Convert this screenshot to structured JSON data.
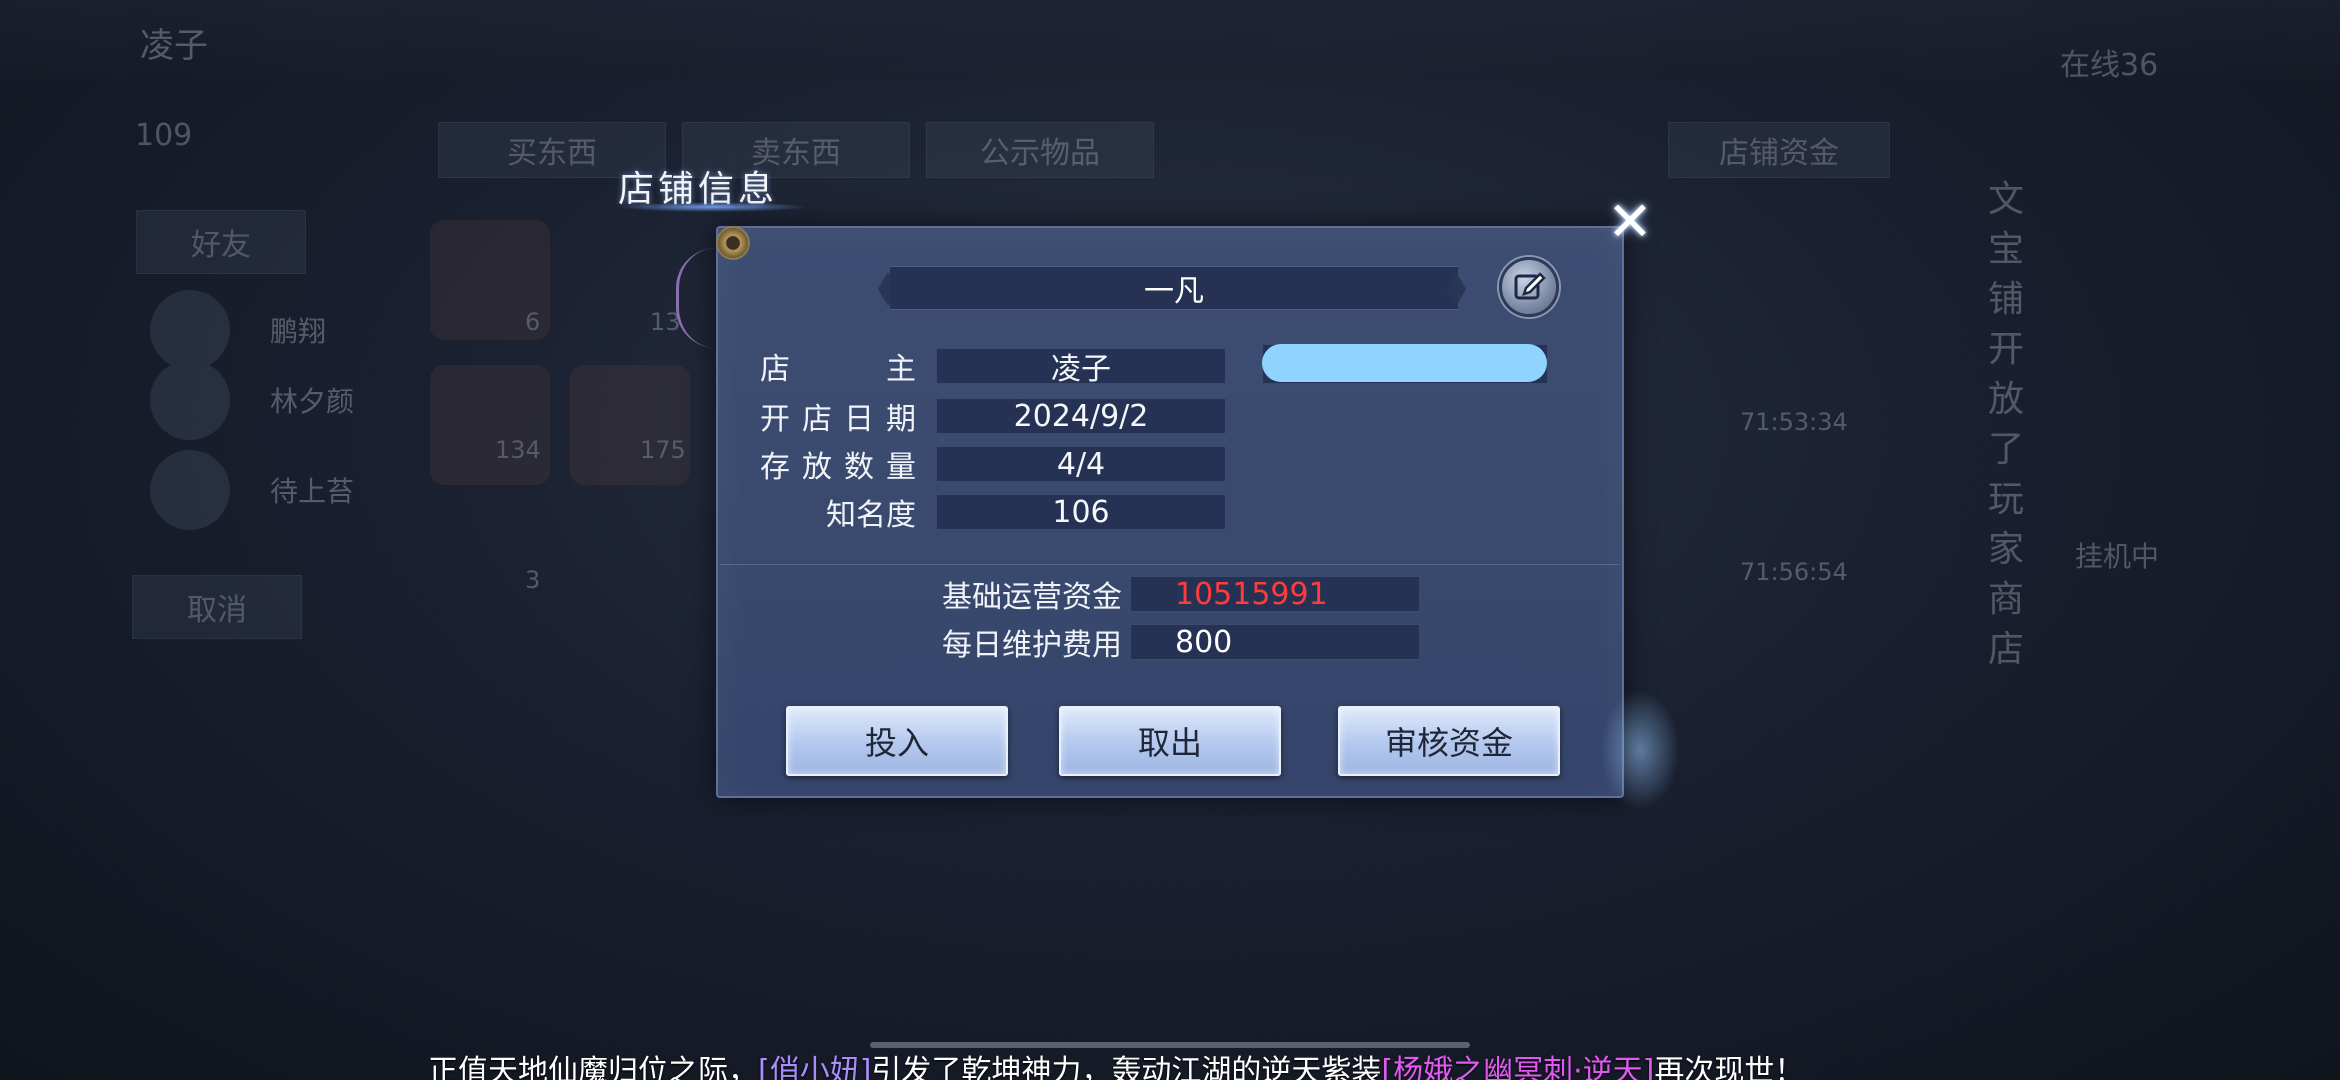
{
  "background": {
    "player_name": "凌子",
    "player_level": "109",
    "online_text": "在线36",
    "tabs": [
      "买东西",
      "卖东西",
      "公示物品"
    ],
    "right_tab": "店铺资金",
    "left_button_1": "好友",
    "left_button_2": "取消",
    "friends": [
      "鹏翔",
      "林夕颜",
      "待上苔"
    ],
    "item_counts": [
      "6",
      "13",
      "134",
      "175",
      "3"
    ],
    "side_vertical_text": "文宝铺开放了玩家商店",
    "right_label": "挂机中",
    "times": [
      "71:53:34",
      "71:56:54"
    ]
  },
  "dialog": {
    "title": "店铺信息",
    "shop_name": "一凡",
    "info_rows": [
      {
        "label": "店　　主",
        "value": "凌子"
      },
      {
        "label": "开店日期",
        "value": "2024/9/2"
      },
      {
        "label": "存放数量",
        "value": "4/4"
      },
      {
        "label": "知名度",
        "value": "106"
      }
    ],
    "funds": [
      {
        "label": "基础运营资金",
        "value": "10515991",
        "color": "#ff3b3b"
      },
      {
        "label": "每日维护费用",
        "value": "800",
        "color": "#ffffff"
      }
    ],
    "buttons": {
      "deposit": "投入",
      "withdraw": "取出",
      "audit": "审核资金"
    },
    "close_symbol": "✕"
  },
  "ticker": {
    "part1": "正值天地仙魔归位之际，",
    "player": "[俏小妞]",
    "part2": "引发了乾坤神力，轰动江湖的逆天紫装",
    "item": "[杨娥之幽冥刺·逆天]",
    "part3": "再次现世！"
  }
}
